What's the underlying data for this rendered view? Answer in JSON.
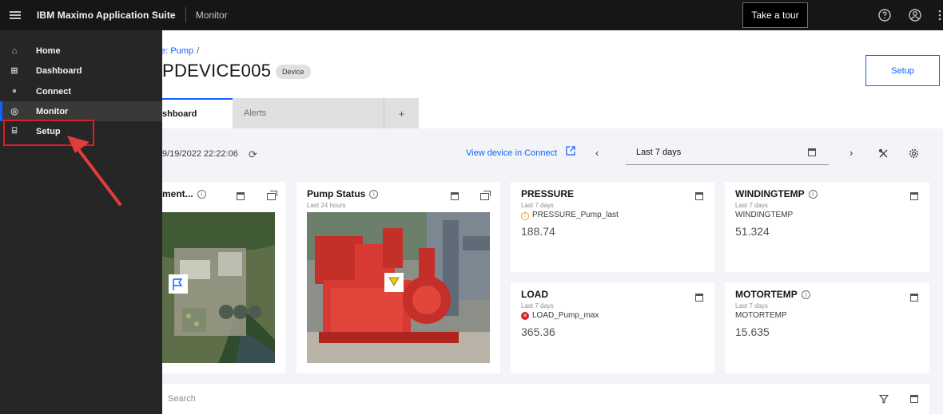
{
  "topbar": {
    "brand": "IBM Maximo Application Suite",
    "product": "Monitor",
    "tour_button": "Take a tour",
    "icons": [
      "help-icon",
      "user-icon",
      "overflow-menu-icon"
    ]
  },
  "breadcrumb": {
    "text": "pe: Pump",
    "separator": "/"
  },
  "device": {
    "name": "PDEVICE005",
    "tag": "Device"
  },
  "setup_button": "Setup",
  "tabs": [
    {
      "label": "shboard",
      "active": true
    },
    {
      "label": "Alerts",
      "active": false
    },
    {
      "label": "+",
      "active": false
    }
  ],
  "toolbar": {
    "timestamp": "9/19/2022 22:22:06",
    "view_connect": "View device in Connect",
    "range": "Last 7 days"
  },
  "cards": {
    "map": {
      "title": "ment..."
    },
    "pump_status": {
      "title": "Pump Status",
      "sub": "Last 24 hours"
    },
    "pressure": {
      "title": "PRESSURE",
      "sub": "Last 7 days",
      "metric": "PRESSURE_Pump_last",
      "value": "188.74"
    },
    "windingtemp": {
      "title": "WINDINGTEMP",
      "sub": "Last 7 days",
      "metric": "WINDINGTEMP",
      "value": "51.324"
    },
    "load": {
      "title": "LOAD",
      "sub": "Last 7 days",
      "metric": "LOAD_Pump_max",
      "value": "365.36"
    },
    "motortemp": {
      "title": "MOTORTEMP",
      "sub": "Last 7 days",
      "metric": "MOTORTEMP",
      "value": "15.635"
    }
  },
  "search": {
    "placeholder": "Search"
  },
  "sidenav": {
    "items": [
      {
        "label": "Home",
        "icon": "home-icon"
      },
      {
        "label": "Dashboard",
        "icon": "dashboard-icon"
      },
      {
        "label": "Connect",
        "icon": "connect-icon"
      },
      {
        "label": "Monitor",
        "icon": "monitor-icon",
        "active": true
      },
      {
        "label": "Setup",
        "icon": "setup-icon",
        "highlighted": true
      }
    ]
  },
  "colors": {
    "accent": "#0f62fe",
    "highlight": "#da1e28",
    "nav_bg": "#262626",
    "topbar_bg": "#161616"
  }
}
